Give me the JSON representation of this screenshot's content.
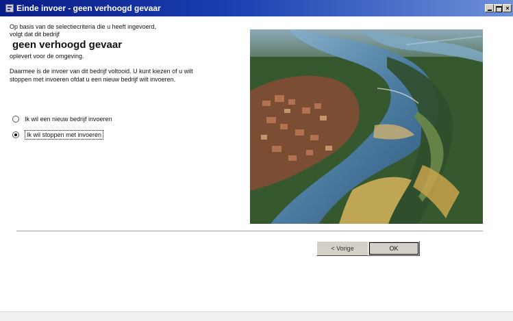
{
  "window": {
    "title": "Einde invoer - geen verhoogd gevaar",
    "controls": {
      "minimize": "minimize",
      "maximize": "maximize",
      "close": "close"
    }
  },
  "intro": {
    "line1": "Op basis van de selectiecriteria die u heeft ingevoerd,",
    "line2": "volgt dat dit bedrijf",
    "highlight": "geen verhoogd gevaar",
    "line3": "oplevert voor de omgeving."
  },
  "paragraph2": "Daarmee is de invoer van dit bedrijf voltooid. U kunt kiezen of u wilt stoppen met invoeren ofdat u een nieuw bedrijf wilt invoeren.",
  "options": [
    {
      "label": "Ik wil een nieuw bedrijf invoeren",
      "selected": false
    },
    {
      "label": "Ik wil stoppen met invoeren",
      "selected": true
    }
  ],
  "buttons": {
    "prev_label": "< Vorige",
    "ok_label": "OK"
  },
  "icons": {
    "app": "access-form-icon",
    "minimize": "minimize-icon",
    "maximize": "maximize-icon",
    "close": "close-icon"
  },
  "colors": {
    "titlebar_start": "#0a1d86",
    "titlebar_end": "#6f91d9",
    "button_face": "#d4d0c8"
  }
}
